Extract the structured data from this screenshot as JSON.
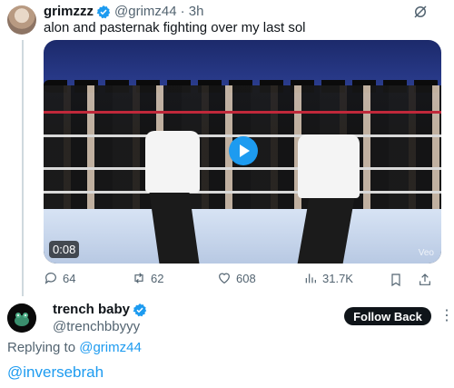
{
  "tweet": {
    "author_name": "grimzzz",
    "author_handle": "@grimz44",
    "time": "· 3h",
    "text": "alon and pasternak fighting over my last sol",
    "video": {
      "timestamp": "0:08",
      "watermark": "Veo"
    },
    "stats": {
      "replies": "64",
      "reposts": "62",
      "likes": "608",
      "views": "31.7K"
    }
  },
  "reply_author": {
    "name": "trench baby",
    "handle": "@trenchbbyyy",
    "follow_label": "Follow Back"
  },
  "reply": {
    "replying_prefix": "Replying to",
    "replying_to": "@grimz44",
    "text": "@inversebrah"
  },
  "colors": {
    "accent": "#1d9bf0",
    "text": "#0f1419",
    "muted": "#536471"
  }
}
